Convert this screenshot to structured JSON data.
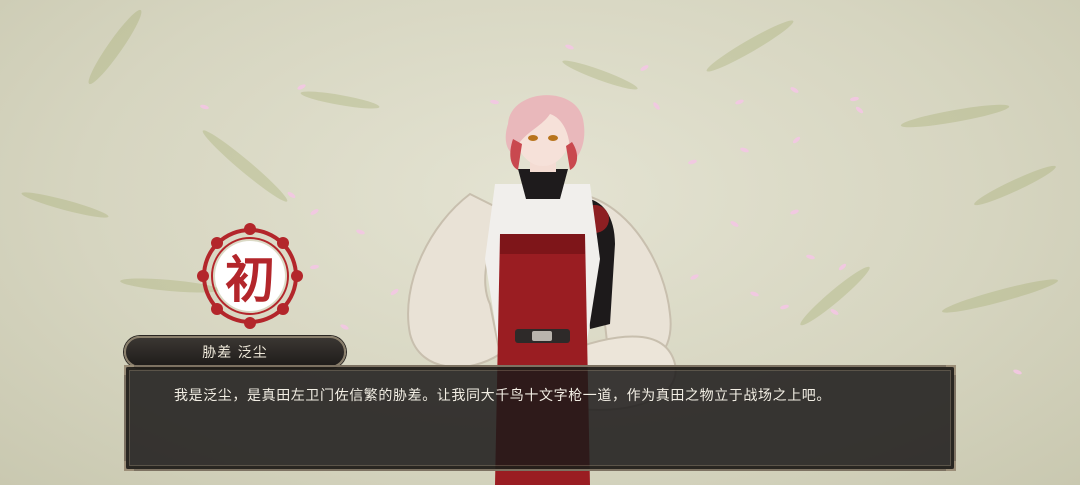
{
  "speaker": {
    "name": "胁差 泛尘"
  },
  "dialogue": {
    "text": "我是泛尘，是真田左卫门佐信繁的胁差。让我同大千鸟十文字枪一道，作为真田之物立于战场之上吧。"
  },
  "badge": {
    "label": "初"
  },
  "colors": {
    "seal_red": "#b3262b",
    "panel_dark": "#1c1a1a",
    "panel_border": "#7d7262",
    "text_light": "#f2eee4"
  }
}
